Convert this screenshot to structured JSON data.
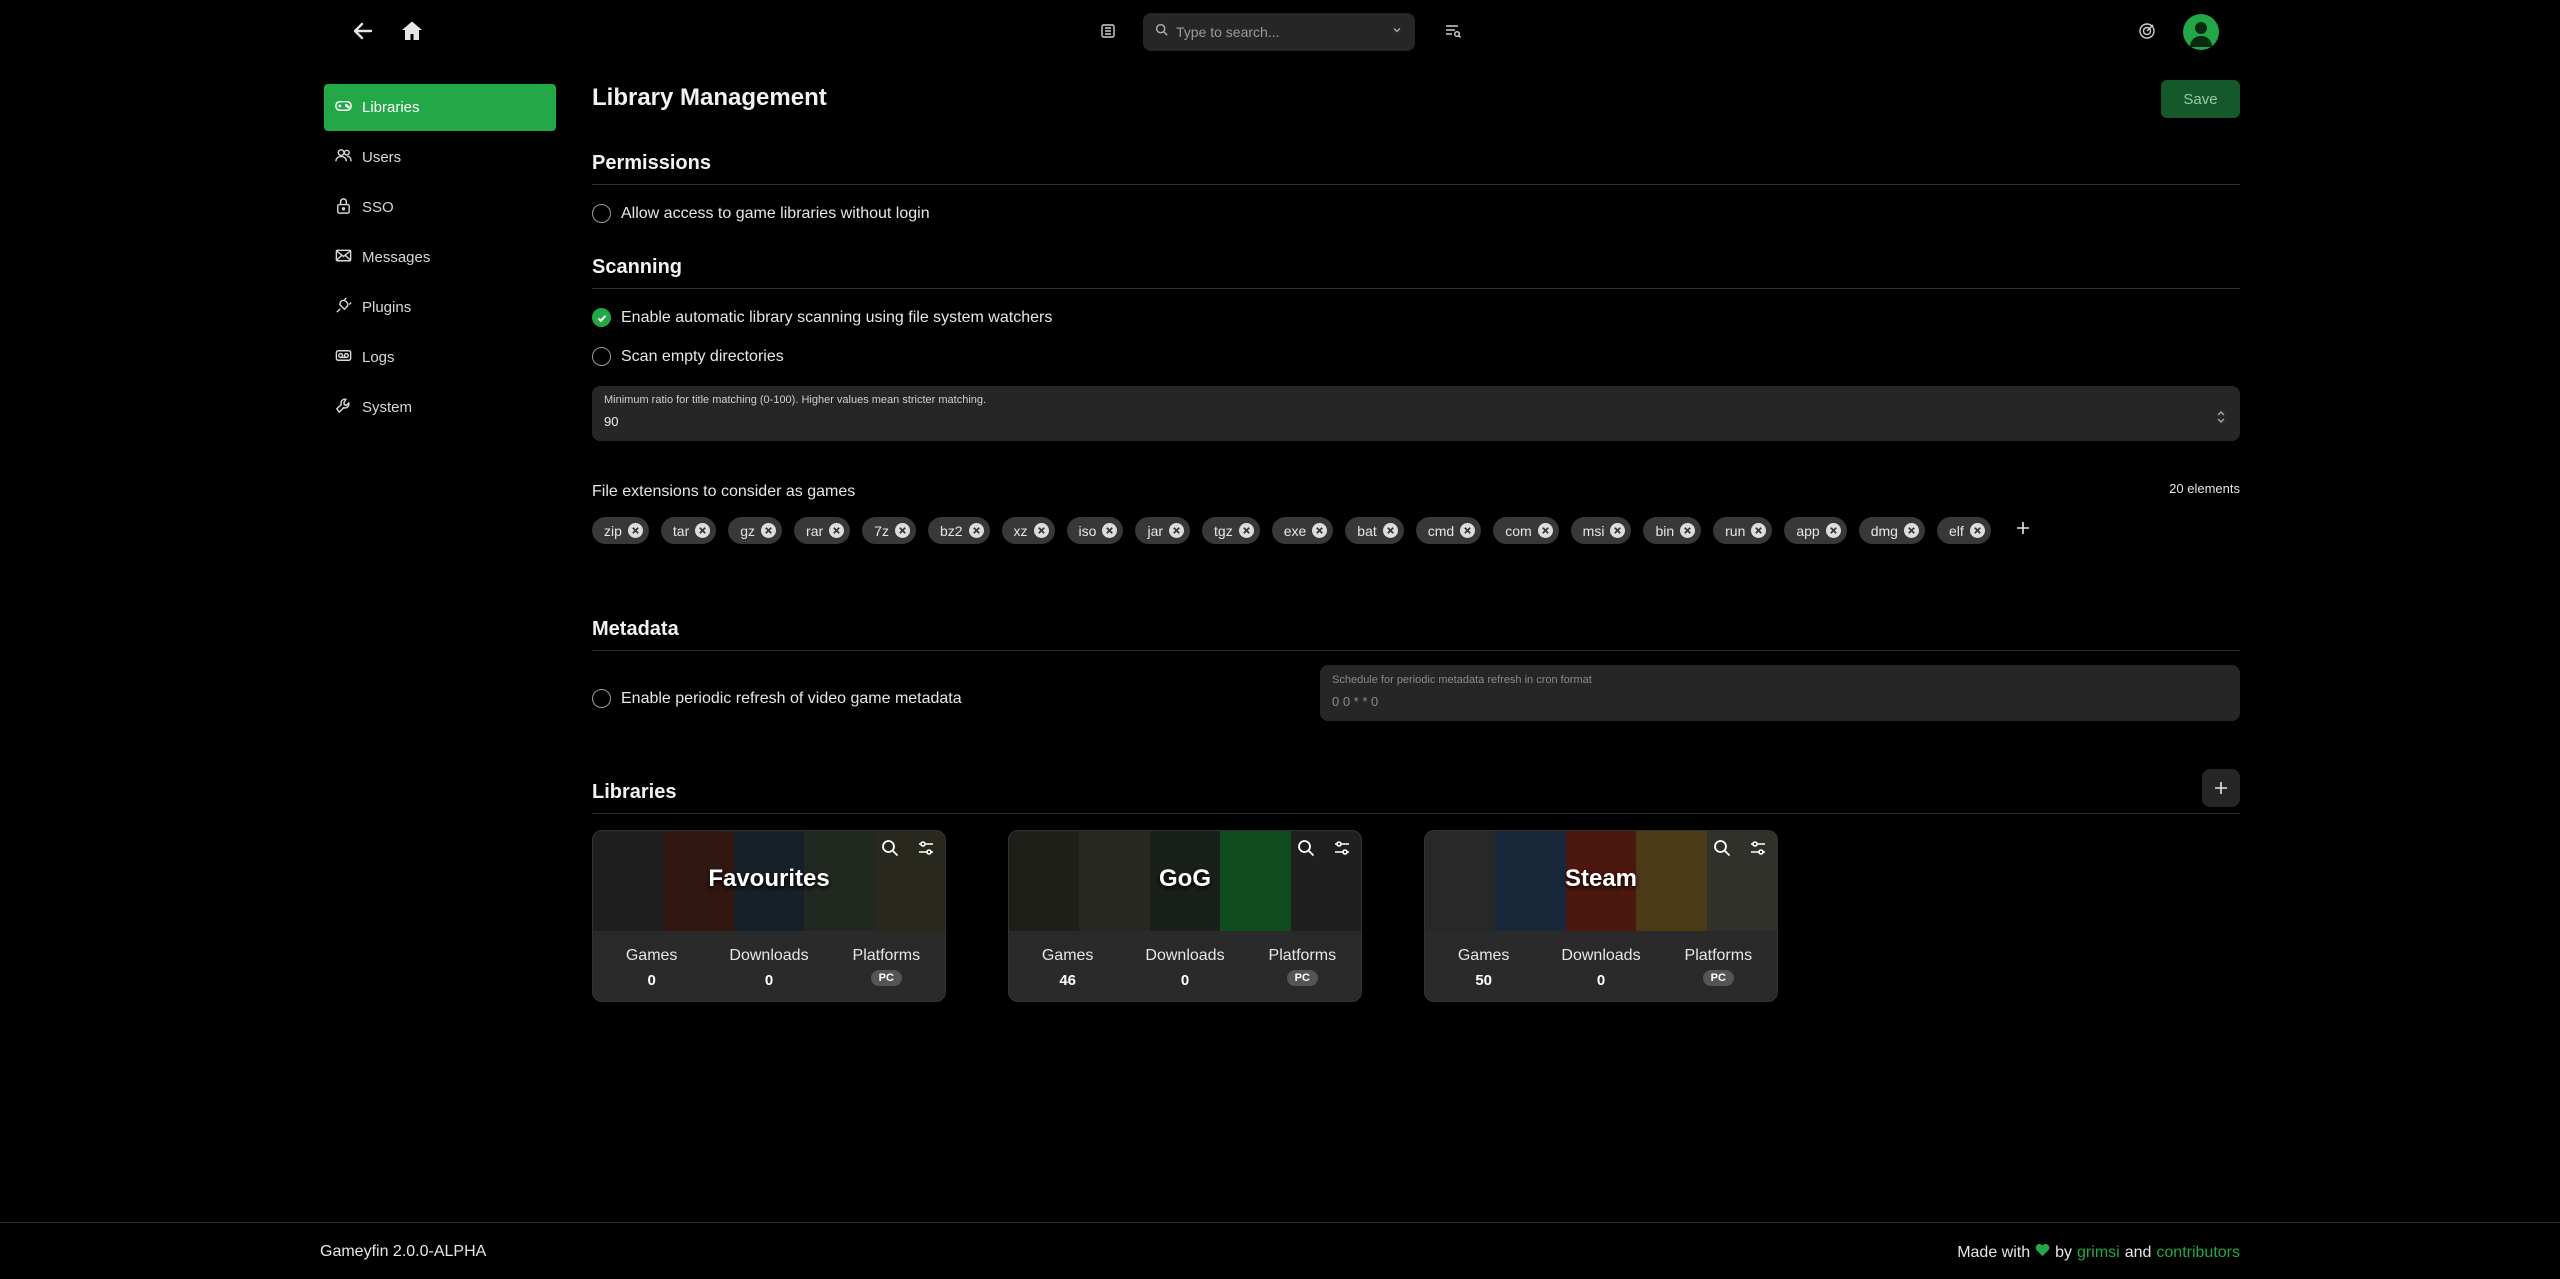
{
  "header": {
    "search_placeholder": "Type to search...",
    "icons": [
      "back-arrow-icon",
      "home-icon",
      "layout-icon",
      "search-icon",
      "chevron-down-icon",
      "filter-list-icon",
      "target-icon",
      "user-avatar-icon"
    ]
  },
  "sidebar": {
    "items": [
      {
        "label": "Libraries",
        "icon": "gamepad-icon",
        "active": true
      },
      {
        "label": "Users",
        "icon": "users-icon",
        "active": false
      },
      {
        "label": "SSO",
        "icon": "lock-icon",
        "active": false
      },
      {
        "label": "Messages",
        "icon": "mail-icon",
        "active": false
      },
      {
        "label": "Plugins",
        "icon": "plug-icon",
        "active": false
      },
      {
        "label": "Logs",
        "icon": "logs-icon",
        "active": false
      },
      {
        "label": "System",
        "icon": "wrench-icon",
        "active": false
      }
    ]
  },
  "main": {
    "title": "Library Management",
    "save_label": "Save",
    "permissions": {
      "title": "Permissions",
      "allow_anon_label": "Allow access to game libraries without login",
      "allow_anon_checked": false
    },
    "scanning": {
      "title": "Scanning",
      "auto_scan_label": "Enable automatic library scanning using file system watchers",
      "auto_scan_checked": true,
      "scan_empty_label": "Scan empty directories",
      "scan_empty_checked": false,
      "ratio_label": "Minimum ratio for title matching (0-100). Higher values mean stricter matching.",
      "ratio_value": "90",
      "extensions_label": "File extensions to consider as games",
      "extensions_count": "20 elements",
      "extensions": [
        "zip",
        "tar",
        "gz",
        "rar",
        "7z",
        "bz2",
        "xz",
        "iso",
        "jar",
        "tgz",
        "exe",
        "bat",
        "cmd",
        "com",
        "msi",
        "bin",
        "run",
        "app",
        "dmg",
        "elf"
      ]
    },
    "metadata": {
      "title": "Metadata",
      "refresh_label": "Enable periodic refresh of video game metadata",
      "refresh_checked": false,
      "cron_label": "Schedule for periodic metadata refresh in cron format",
      "cron_value": "0 0 * * 0"
    },
    "libraries": {
      "title": "Libraries",
      "stat_labels": {
        "games": "Games",
        "downloads": "Downloads",
        "platforms": "Platforms"
      },
      "items": [
        {
          "name": "Favourites",
          "games": "0",
          "downloads": "0",
          "platform": "PC",
          "colors": [
            "#3a3a3a",
            "#5a2a22",
            "#2b3a4a",
            "#3d4a3a",
            "#4a4a3a"
          ]
        },
        {
          "name": "GoG",
          "games": "46",
          "downloads": "0",
          "platform": "PC",
          "colors": [
            "#3a3a2e",
            "#4a4a40",
            "#2e3a2e",
            "#1f8a3a",
            "#3a3a3a"
          ]
        },
        {
          "name": "Steam",
          "games": "50",
          "downloads": "0",
          "platform": "PC",
          "colors": [
            "#4a4a4a",
            "#2c4a6a",
            "#8a2a1a",
            "#8a6a2a",
            "#5a5a50"
          ]
        }
      ]
    }
  },
  "footer": {
    "version": "Gameyfin 2.0.0-ALPHA",
    "made_with": "Made with",
    "by": "by",
    "author": "grimsi",
    "and": "and",
    "contributors": "contributors",
    "colors": {
      "accent": "#22a846"
    }
  }
}
